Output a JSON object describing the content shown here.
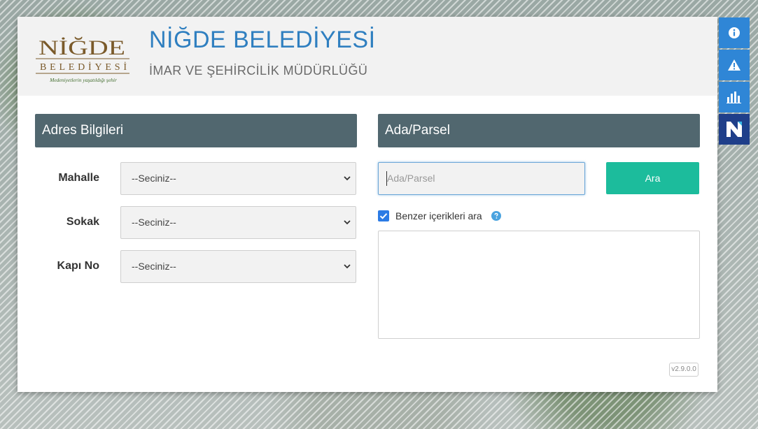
{
  "header": {
    "logo_name": "NİĞDE",
    "logo_sub": "BELEDİYESİ",
    "logo_tagline": "Medeniyetlerin yaşatıldığı şehir",
    "title": "NİĞDE BELEDİYESİ",
    "subtitle": "İMAR VE ŞEHİRCİLİK MÜDÜRLÜĞÜ"
  },
  "address": {
    "heading": "Adres Bilgileri",
    "fields": [
      {
        "label": "Mahalle",
        "value": "--Seciniz--"
      },
      {
        "label": "Sokak",
        "value": "--Seciniz--"
      },
      {
        "label": "Kapı No",
        "value": "--Seciniz--"
      }
    ]
  },
  "parcel": {
    "heading": "Ada/Parsel",
    "placeholder": "Ada/Parsel",
    "search_label": "Ara",
    "similar_label": "Benzer içerikleri ara",
    "similar_checked": true
  },
  "version": "v2.9.0.0",
  "sidebar": {
    "buttons": [
      {
        "icon": "info-icon"
      },
      {
        "icon": "warning-icon"
      },
      {
        "icon": "bar-chart-icon"
      },
      {
        "icon": "netcad-logo-icon"
      }
    ]
  },
  "colors": {
    "title": "#2f7fc0",
    "section_header": "#51676f",
    "search_button": "#1cbc9c",
    "side_button": "#2f86d6",
    "side_logo_button": "#1f3f8a",
    "logo_brown": "#7a5a2a"
  }
}
